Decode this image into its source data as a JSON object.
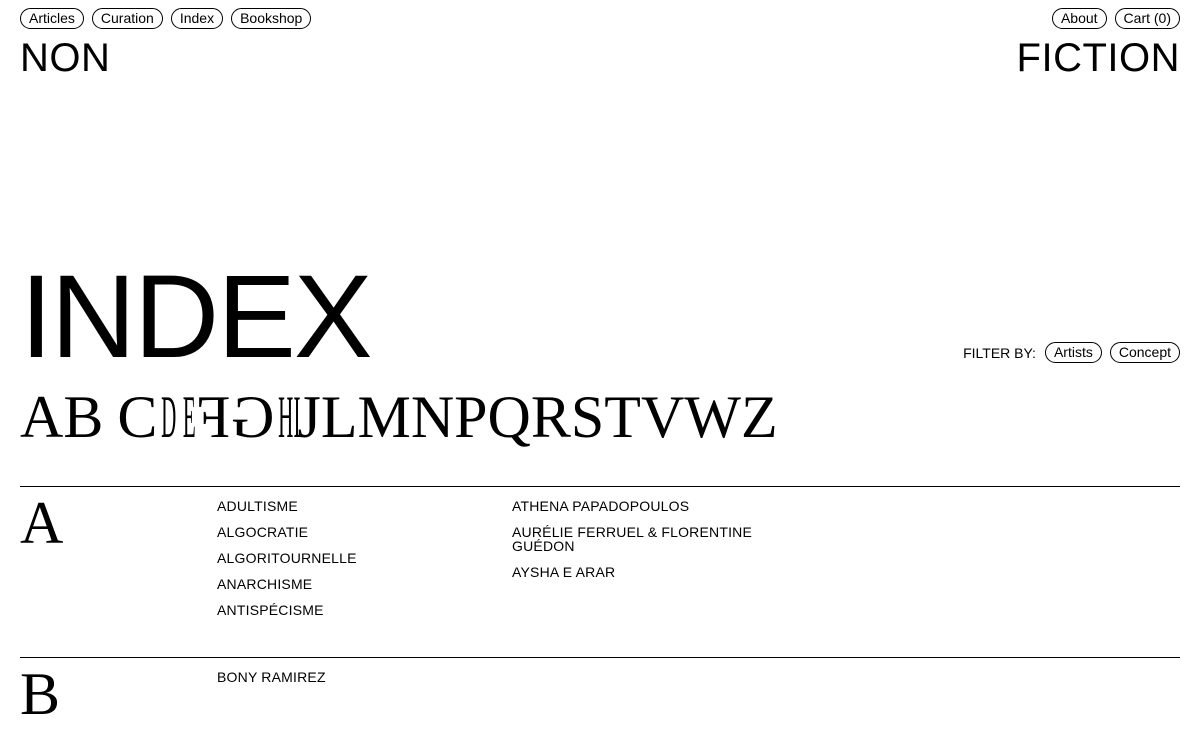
{
  "nav": {
    "left": [
      "Articles",
      "Curation",
      "Index",
      "Bookshop"
    ],
    "right": [
      "About",
      "Cart (0)"
    ]
  },
  "brand": {
    "left": "NON",
    "right": "FICTION"
  },
  "page": {
    "title": "INDEX"
  },
  "filter": {
    "label": "FILTER BY:",
    "options": [
      "Artists",
      "Concept"
    ]
  },
  "alphabet": [
    "A",
    "B",
    "C",
    "D",
    "E",
    "F",
    "G",
    "H",
    "I",
    "J",
    "L",
    "M",
    "N",
    "P",
    "Q",
    "R",
    "S",
    "T",
    "V",
    "W",
    "Z"
  ],
  "sections": [
    {
      "letter": "A",
      "concepts": [
        "ADULTISME",
        "ALGOCRATIE",
        "ALGORITOURNELLE",
        "ANARCHISME",
        "ANTISPÉCISME"
      ],
      "artists": [
        "ATHENA PAPADOPOULOS",
        "AURÉLIE FERRUEL & FLORENTINE GUÉDON",
        "AYSHA E ARAR"
      ]
    },
    {
      "letter": "B",
      "concepts": [
        "BONY RAMIREZ"
      ],
      "artists": []
    }
  ]
}
